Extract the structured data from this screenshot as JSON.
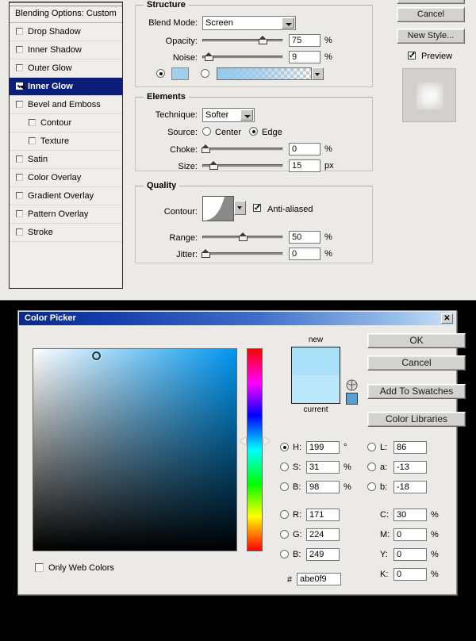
{
  "layer_style": {
    "styles_list": {
      "header": "Blending Options: Custom",
      "items": [
        {
          "label": "Drop Shadow",
          "checked": false,
          "indent": false,
          "selected": false
        },
        {
          "label": "Inner Shadow",
          "checked": false,
          "indent": false,
          "selected": false
        },
        {
          "label": "Outer Glow",
          "checked": false,
          "indent": false,
          "selected": false
        },
        {
          "label": "Inner Glow",
          "checked": true,
          "indent": false,
          "selected": true
        },
        {
          "label": "Bevel and Emboss",
          "checked": false,
          "indent": false,
          "selected": false
        },
        {
          "label": "Contour",
          "checked": false,
          "indent": true,
          "selected": false
        },
        {
          "label": "Texture",
          "checked": false,
          "indent": true,
          "selected": false
        },
        {
          "label": "Satin",
          "checked": false,
          "indent": false,
          "selected": false
        },
        {
          "label": "Color Overlay",
          "checked": false,
          "indent": false,
          "selected": false
        },
        {
          "label": "Gradient Overlay",
          "checked": false,
          "indent": false,
          "selected": false
        },
        {
          "label": "Pattern Overlay",
          "checked": false,
          "indent": false,
          "selected": false
        },
        {
          "label": "Stroke",
          "checked": false,
          "indent": false,
          "selected": false
        }
      ]
    },
    "structure": {
      "legend": "Structure",
      "blend_mode_label": "Blend Mode:",
      "blend_mode_value": "Screen",
      "opacity_label": "Opacity:",
      "opacity_value": "75",
      "opacity_unit": "%",
      "noise_label": "Noise:",
      "noise_value": "9",
      "noise_unit": "%",
      "fill_type": "color",
      "color_swatch": "#9fcfeb"
    },
    "elements": {
      "legend": "Elements",
      "technique_label": "Technique:",
      "technique_value": "Softer",
      "source_label": "Source:",
      "source_center_label": "Center",
      "source_edge_label": "Edge",
      "source_value": "Edge",
      "choke_label": "Choke:",
      "choke_value": "0",
      "choke_unit": "%",
      "size_label": "Size:",
      "size_value": "15",
      "size_unit": "px"
    },
    "quality": {
      "legend": "Quality",
      "contour_label": "Contour:",
      "antialiased_label": "Anti-aliased",
      "antialiased_checked": true,
      "range_label": "Range:",
      "range_value": "50",
      "range_unit": "%",
      "jitter_label": "Jitter:",
      "jitter_value": "0",
      "jitter_unit": "%"
    },
    "buttons": {
      "cancel": "Cancel",
      "new_style": "New Style...",
      "preview_label": "Preview",
      "preview_checked": true
    }
  },
  "color_picker": {
    "title": "Color Picker",
    "close_icon": "close-icon",
    "new_label": "new",
    "current_label": "current",
    "new_color": "#abe0f9",
    "current_color": "#bce7fb",
    "buttons": {
      "ok": "OK",
      "cancel": "Cancel",
      "add_to_swatches": "Add To Swatches",
      "color_libraries": "Color Libraries"
    },
    "only_web_colors_label": "Only Web Colors",
    "only_web_colors_checked": false,
    "hsb": [
      {
        "key": "H:",
        "value": "199",
        "unit": "°",
        "selected": true
      },
      {
        "key": "S:",
        "value": "31",
        "unit": "%",
        "selected": false
      },
      {
        "key": "B:",
        "value": "98",
        "unit": "%",
        "selected": false
      }
    ],
    "rgb": [
      {
        "key": "R:",
        "value": "171",
        "unit": "",
        "selected": false
      },
      {
        "key": "G:",
        "value": "224",
        "unit": "",
        "selected": false
      },
      {
        "key": "B:",
        "value": "249",
        "unit": "",
        "selected": false
      }
    ],
    "lab": [
      {
        "key": "L:",
        "value": "86",
        "unit": "",
        "selected": false
      },
      {
        "key": "a:",
        "value": "-13",
        "unit": "",
        "selected": false
      },
      {
        "key": "b:",
        "value": "-18",
        "unit": "",
        "selected": false
      }
    ],
    "cmyk": [
      {
        "key": "C:",
        "value": "30",
        "unit": "%"
      },
      {
        "key": "M:",
        "value": "0",
        "unit": "%"
      },
      {
        "key": "Y:",
        "value": "0",
        "unit": "%"
      },
      {
        "key": "K:",
        "value": "0",
        "unit": "%"
      }
    ],
    "hex_label": "#",
    "hex_value": "abe0f9"
  }
}
